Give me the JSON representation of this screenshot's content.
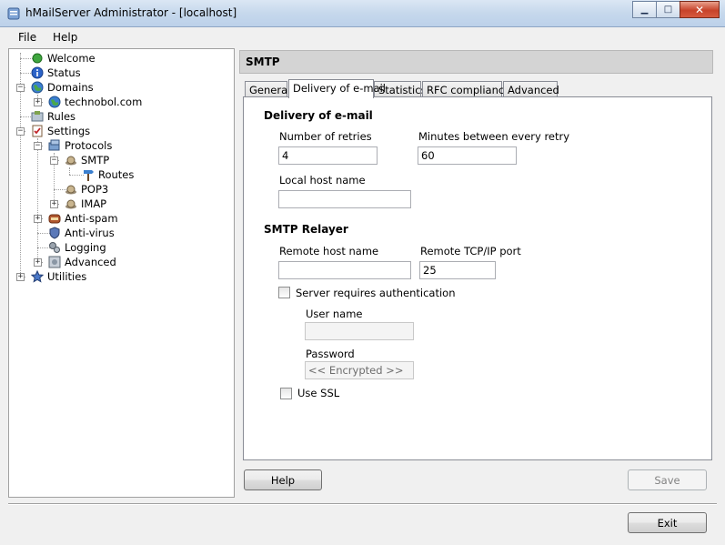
{
  "window": {
    "title": "hMailServer Administrator - [localhost]",
    "minimize": "▁",
    "maximize": "□",
    "close": "✕"
  },
  "menu": {
    "file": "File",
    "help": "Help"
  },
  "tree": {
    "welcome": "Welcome",
    "status": "Status",
    "domains": "Domains",
    "domain_technobol": "technobol.com",
    "rules": "Rules",
    "settings": "Settings",
    "protocols": "Protocols",
    "smtp": "SMTP",
    "routes": "Routes",
    "pop3": "POP3",
    "imap": "IMAP",
    "antispam": "Anti-spam",
    "antivirus": "Anti-virus",
    "logging": "Logging",
    "advanced": "Advanced",
    "utilities": "Utilities",
    "expand_plus": "+",
    "expand_minus": "−"
  },
  "panel": {
    "title": "SMTP"
  },
  "tabs": {
    "general": "General",
    "delivery": "Delivery of e-mail",
    "statistics": "Statistics",
    "rfc": "RFC compliance",
    "advanced": "Advanced"
  },
  "delivery": {
    "section_title": "Delivery of e-mail",
    "retries_label": "Number of retries",
    "retries_value": "4",
    "minutes_label": "Minutes between every retry",
    "minutes_value": "60",
    "localhost_label": "Local host name",
    "localhost_value": ""
  },
  "relayer": {
    "section_title": "SMTP Relayer",
    "remote_host_label": "Remote host name",
    "remote_host_value": "",
    "port_label": "Remote TCP/IP port",
    "port_value": "25",
    "auth_label": "Server requires authentication",
    "username_label": "User name",
    "username_value": "",
    "password_label": "Password",
    "password_value": "<< Encrypted >>",
    "ssl_label": "Use SSL"
  },
  "buttons": {
    "help": "Help",
    "save": "Save",
    "exit": "Exit"
  }
}
